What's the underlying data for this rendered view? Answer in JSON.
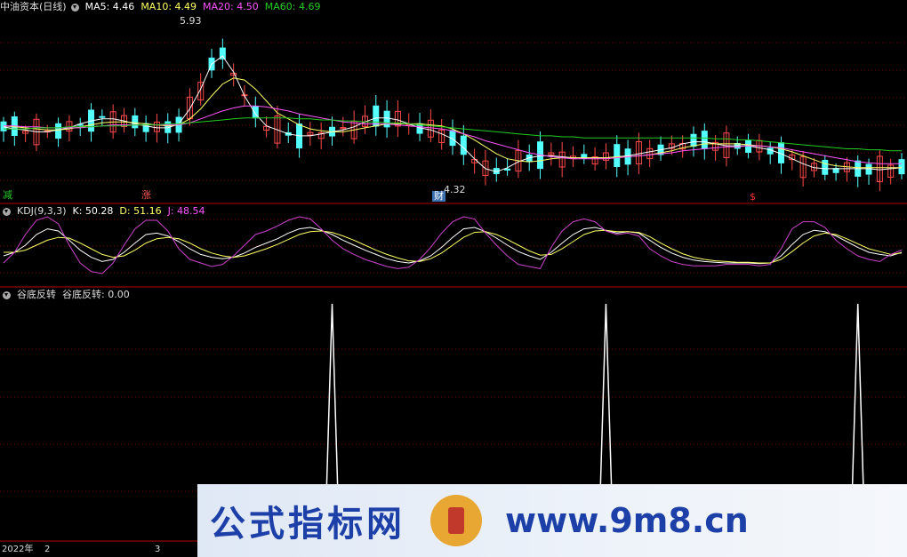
{
  "price_panel": {
    "title": "中油资本(日线)",
    "ma5": "MA5: 4.46",
    "ma10": "MA10: 4.49",
    "ma20": "MA20: 4.50",
    "ma60": "MA60: 4.69",
    "high_label": "5.93",
    "low_label": "4.32",
    "tag_left": "减",
    "tag_up": "涨",
    "tag_fin": "财",
    "tag_dollar": "$"
  },
  "kdj_panel": {
    "title": "KDJ(9,3,3)",
    "k": "K: 50.28",
    "d": "D: 51.16",
    "j": "J: 48.54"
  },
  "indicator_panel": {
    "title": "谷底反转",
    "value": "谷底反转: 0.00"
  },
  "date_axis": {
    "year": "2022年",
    "m2": "2",
    "m3": "3"
  },
  "watermark": {
    "text": "公式指标网",
    "url": "www.9m8.cn"
  },
  "colors": {
    "up": "#ff4a4a",
    "down": "#54ffff",
    "ma5": "#ffffff",
    "ma10": "#ffff66",
    "ma20": "#ff55ff",
    "ma60": "#22cc22",
    "grid": "#7a0000",
    "separator": "#b00000"
  },
  "chart_data": {
    "type": "candlestick",
    "ylim": [
      4.2,
      6.0
    ],
    "ma_series": [
      {
        "name": "MA5",
        "values": [
          4.87,
          4.85,
          4.84,
          4.82,
          4.82,
          4.84,
          4.86,
          4.9,
          4.93,
          4.95,
          4.95,
          4.93,
          4.9,
          4.88,
          4.86,
          4.86,
          4.9,
          5.05,
          5.25,
          5.5,
          5.58,
          5.42,
          5.18,
          5.0,
          4.88,
          4.84,
          4.8,
          4.78,
          4.78,
          4.8,
          4.82,
          4.84,
          4.87,
          4.92,
          4.96,
          4.96,
          4.94,
          4.9,
          4.86,
          4.84,
          4.8,
          4.75,
          4.66,
          4.55,
          4.45,
          4.42,
          4.46,
          4.52,
          4.56,
          4.58,
          4.58,
          4.57,
          4.56,
          4.56,
          4.56,
          4.56,
          4.57,
          4.58,
          4.6,
          4.62,
          4.64,
          4.66,
          4.7,
          4.72,
          4.72,
          4.7,
          4.68,
          4.68,
          4.68,
          4.66,
          4.64,
          4.6,
          4.55,
          4.5,
          4.46,
          4.45,
          4.45,
          4.45,
          4.45,
          4.45,
          4.44,
          4.45,
          4.46
        ]
      },
      {
        "name": "MA10",
        "values": [
          4.88,
          4.87,
          4.86,
          4.85,
          4.84,
          4.84,
          4.85,
          4.87,
          4.89,
          4.91,
          4.92,
          4.92,
          4.91,
          4.9,
          4.89,
          4.88,
          4.89,
          4.95,
          5.05,
          5.18,
          5.3,
          5.36,
          5.34,
          5.25,
          5.13,
          5.01,
          4.95,
          4.89,
          4.85,
          4.83,
          4.82,
          4.82,
          4.84,
          4.86,
          4.88,
          4.9,
          4.9,
          4.9,
          4.9,
          4.89,
          4.88,
          4.85,
          4.8,
          4.74,
          4.67,
          4.6,
          4.55,
          4.53,
          4.52,
          4.53,
          4.55,
          4.56,
          4.56,
          4.56,
          4.56,
          4.56,
          4.57,
          4.57,
          4.58,
          4.59,
          4.61,
          4.63,
          4.66,
          4.68,
          4.7,
          4.7,
          4.7,
          4.7,
          4.69,
          4.68,
          4.67,
          4.65,
          4.62,
          4.58,
          4.54,
          4.5,
          4.48,
          4.47,
          4.46,
          4.46,
          4.46,
          4.46,
          4.46
        ]
      },
      {
        "name": "MA20",
        "values": [
          4.88,
          4.88,
          4.87,
          4.87,
          4.86,
          4.86,
          4.86,
          4.86,
          4.87,
          4.88,
          4.89,
          4.89,
          4.89,
          4.89,
          4.89,
          4.89,
          4.89,
          4.91,
          4.95,
          4.99,
          5.03,
          5.06,
          5.08,
          5.08,
          5.07,
          5.05,
          5.03,
          5.0,
          4.98,
          4.96,
          4.94,
          4.92,
          4.91,
          4.9,
          4.9,
          4.9,
          4.89,
          4.88,
          4.87,
          4.86,
          4.85,
          4.83,
          4.8,
          4.77,
          4.73,
          4.7,
          4.67,
          4.64,
          4.61,
          4.59,
          4.57,
          4.56,
          4.55,
          4.55,
          4.55,
          4.55,
          4.56,
          4.57,
          4.58,
          4.59,
          4.6,
          4.61,
          4.63,
          4.64,
          4.65,
          4.66,
          4.67,
          4.67,
          4.68,
          4.68,
          4.67,
          4.66,
          4.64,
          4.62,
          4.6,
          4.58,
          4.56,
          4.54,
          4.52,
          4.51,
          4.5,
          4.5,
          4.5
        ]
      },
      {
        "name": "MA60",
        "values": [
          4.85,
          4.85,
          4.85,
          4.86,
          4.86,
          4.86,
          4.87,
          4.87,
          4.87,
          4.88,
          4.88,
          4.88,
          4.89,
          4.89,
          4.89,
          4.9,
          4.9,
          4.91,
          4.92,
          4.93,
          4.94,
          4.95,
          4.96,
          4.96,
          4.96,
          4.96,
          4.96,
          4.95,
          4.95,
          4.94,
          4.94,
          4.93,
          4.93,
          4.92,
          4.92,
          4.91,
          4.91,
          4.9,
          4.89,
          4.88,
          4.87,
          4.86,
          4.85,
          4.84,
          4.83,
          4.82,
          4.81,
          4.8,
          4.79,
          4.78,
          4.78,
          4.77,
          4.77,
          4.76,
          4.76,
          4.76,
          4.76,
          4.76,
          4.76,
          4.76,
          4.76,
          4.76,
          4.76,
          4.76,
          4.76,
          4.75,
          4.75,
          4.74,
          4.74,
          4.73,
          4.72,
          4.71,
          4.7,
          4.69,
          4.68,
          4.67,
          4.66,
          4.65,
          4.65,
          4.64,
          4.64,
          4.63,
          4.63
        ]
      }
    ],
    "kdj": {
      "ylim": [
        0,
        100
      ],
      "K": [
        40,
        45,
        55,
        70,
        78,
        75,
        62,
        48,
        38,
        32,
        35,
        45,
        58,
        70,
        72,
        68,
        60,
        50,
        42,
        38,
        36,
        38,
        44,
        52,
        58,
        64,
        72,
        78,
        80,
        76,
        70,
        62,
        55,
        48,
        42,
        36,
        32,
        30,
        33,
        40,
        52,
        66,
        78,
        80,
        74,
        65,
        55,
        46,
        40,
        35,
        45,
        58,
        70,
        78,
        80,
        76,
        72,
        74,
        72,
        62,
        52,
        44,
        38,
        34,
        32,
        31,
        30,
        30,
        30,
        29,
        30,
        40,
        56,
        70,
        76,
        74,
        68,
        60,
        52,
        45,
        42,
        40,
        45
      ],
      "D": [
        45,
        45,
        48,
        55,
        62,
        66,
        65,
        58,
        50,
        42,
        38,
        40,
        48,
        58,
        64,
        66,
        64,
        58,
        50,
        44,
        40,
        38,
        40,
        45,
        50,
        56,
        63,
        70,
        74,
        75,
        73,
        68,
        62,
        55,
        48,
        42,
        37,
        33,
        32,
        36,
        44,
        55,
        66,
        73,
        74,
        70,
        63,
        55,
        47,
        41,
        42,
        50,
        60,
        70,
        75,
        76,
        74,
        74,
        73,
        67,
        58,
        50,
        43,
        38,
        35,
        33,
        32,
        31,
        31,
        30,
        30,
        35,
        46,
        58,
        68,
        72,
        70,
        64,
        57,
        50,
        46,
        42,
        44
      ],
      "J": [
        30,
        45,
        70,
        90,
        95,
        85,
        55,
        30,
        18,
        15,
        30,
        55,
        78,
        90,
        90,
        75,
        50,
        35,
        30,
        25,
        28,
        40,
        55,
        70,
        75,
        82,
        90,
        95,
        92,
        78,
        62,
        50,
        42,
        35,
        30,
        25,
        22,
        24,
        35,
        52,
        72,
        88,
        95,
        92,
        72,
        55,
        40,
        28,
        25,
        22,
        52,
        75,
        88,
        92,
        88,
        75,
        70,
        72,
        68,
        50,
        40,
        32,
        28,
        26,
        26,
        26,
        28,
        28,
        28,
        26,
        28,
        50,
        78,
        88,
        88,
        80,
        62,
        50,
        40,
        35,
        32,
        42,
        48
      ]
    },
    "signal": {
      "ylim": [
        0,
        1
      ],
      "spike_index": [
        30,
        55,
        78
      ],
      "values_note": "spikes to 1"
    }
  }
}
